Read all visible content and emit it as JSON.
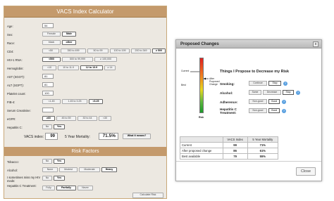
{
  "calc": {
    "title": "VACS Index Calculator",
    "age": {
      "label": "Age:",
      "value": "54"
    },
    "sex": {
      "label": "Sex:",
      "options": [
        "Female",
        "Male"
      ],
      "selected": 1
    },
    "race": {
      "label": "Race:",
      "options": [
        "black",
        "other"
      ],
      "selected": 1
    },
    "cd4": {
      "label": "CD4:",
      "options": [
        "<50",
        "350 to 499",
        "50 to 99",
        "100 to 199",
        "200 to 349",
        "≥ 500"
      ],
      "selected": 5
    },
    "rna": {
      "label": "HIV-1 RNA:",
      "options": [
        "<500",
        "500 to 99,999",
        "≥ 100,000"
      ],
      "selected": 0
    },
    "hemo": {
      "label": "Hemoglobin:",
      "options": [
        "<10",
        "10 to 11.9",
        "12 to 13.9",
        "≥ 14"
      ],
      "selected": 2
    },
    "ast": {
      "label": "AST (SGOT):",
      "value": "81"
    },
    "alt": {
      "label": "ALT (SGPT):",
      "value": "81"
    },
    "platelet": {
      "label": "Platelet count:",
      "value": "100"
    },
    "fib4": {
      "label": "FIB-4:",
      "options": [
        "<1.45",
        "1.45 to 3.25",
        ">3.25"
      ],
      "selected": 2
    },
    "creat": {
      "label": "Serum Creatinine:",
      "value": ""
    },
    "egfr": {
      "label": "eGFR:",
      "options": [
        "≥60",
        "45 to 59",
        "30 to 44",
        "<30"
      ],
      "selected": 0
    },
    "hepc": {
      "label": "Hepatitis C:",
      "options": [
        "No",
        "Yes"
      ],
      "selected": 1
    },
    "vacs": {
      "label": "VACS index:",
      "value": "99",
      "mort_label": "5 Year Mortality:",
      "mort_value": "71.5%",
      "btn": "What it means?"
    },
    "risk_title": "Risk Factors",
    "tobacco": {
      "label": "Tobacco:",
      "options": [
        "No",
        "Yes"
      ],
      "selected": 1
    },
    "alcohol": {
      "label": "Alcohol:",
      "options": [
        "None",
        "Modest",
        "Moderate",
        "Heavy"
      ],
      "selected": 3
    },
    "meds": {
      "label": "I sometimes miss my HIV meds:",
      "options": [
        "No",
        "Yes"
      ],
      "selected": 1
    },
    "hcvtx": {
      "label": "Hepatitis C Treatment:",
      "options": [
        "Fully",
        "Partially",
        "Never"
      ],
      "selected": 1
    },
    "calc_btn": "Calculate Risk"
  },
  "modal": {
    "title": "Proposed Changes",
    "close_x": "x",
    "close_btn": "Close",
    "labels": {
      "current": "Current",
      "best": "Best",
      "after": "After Proposed Change",
      "risk": "Risk"
    },
    "heading": "Things I Propose to Decrease my Risk",
    "smoking": {
      "label": "Smoking:",
      "options": [
        "Continue",
        "Stop"
      ],
      "selected": 1
    },
    "alcohol": {
      "label": "Alcohol:",
      "options": [
        "Same",
        "Decrease",
        "Stop"
      ],
      "selected": 2
    },
    "adherence": {
      "label": "Adherence:",
      "options": [
        "Non-good",
        "Good"
      ],
      "selected": 1
    },
    "hepc": {
      "label": "Hepatitis C Treatment:",
      "options": [
        "Non-good",
        "Good"
      ],
      "selected": 1
    },
    "table": {
      "headers": [
        "",
        "VACS Index",
        "5 Year Mortality"
      ],
      "rows": [
        [
          "Current",
          "99",
          "71%"
        ],
        [
          "After proposed change",
          "86",
          "61%"
        ],
        [
          "Best available",
          "79",
          "55%"
        ]
      ]
    }
  },
  "colors": {
    "panel": "#c49a6c",
    "risk_top": "#e02020",
    "risk_bottom": "#1a9a2a",
    "help": "#5aa0e0"
  }
}
